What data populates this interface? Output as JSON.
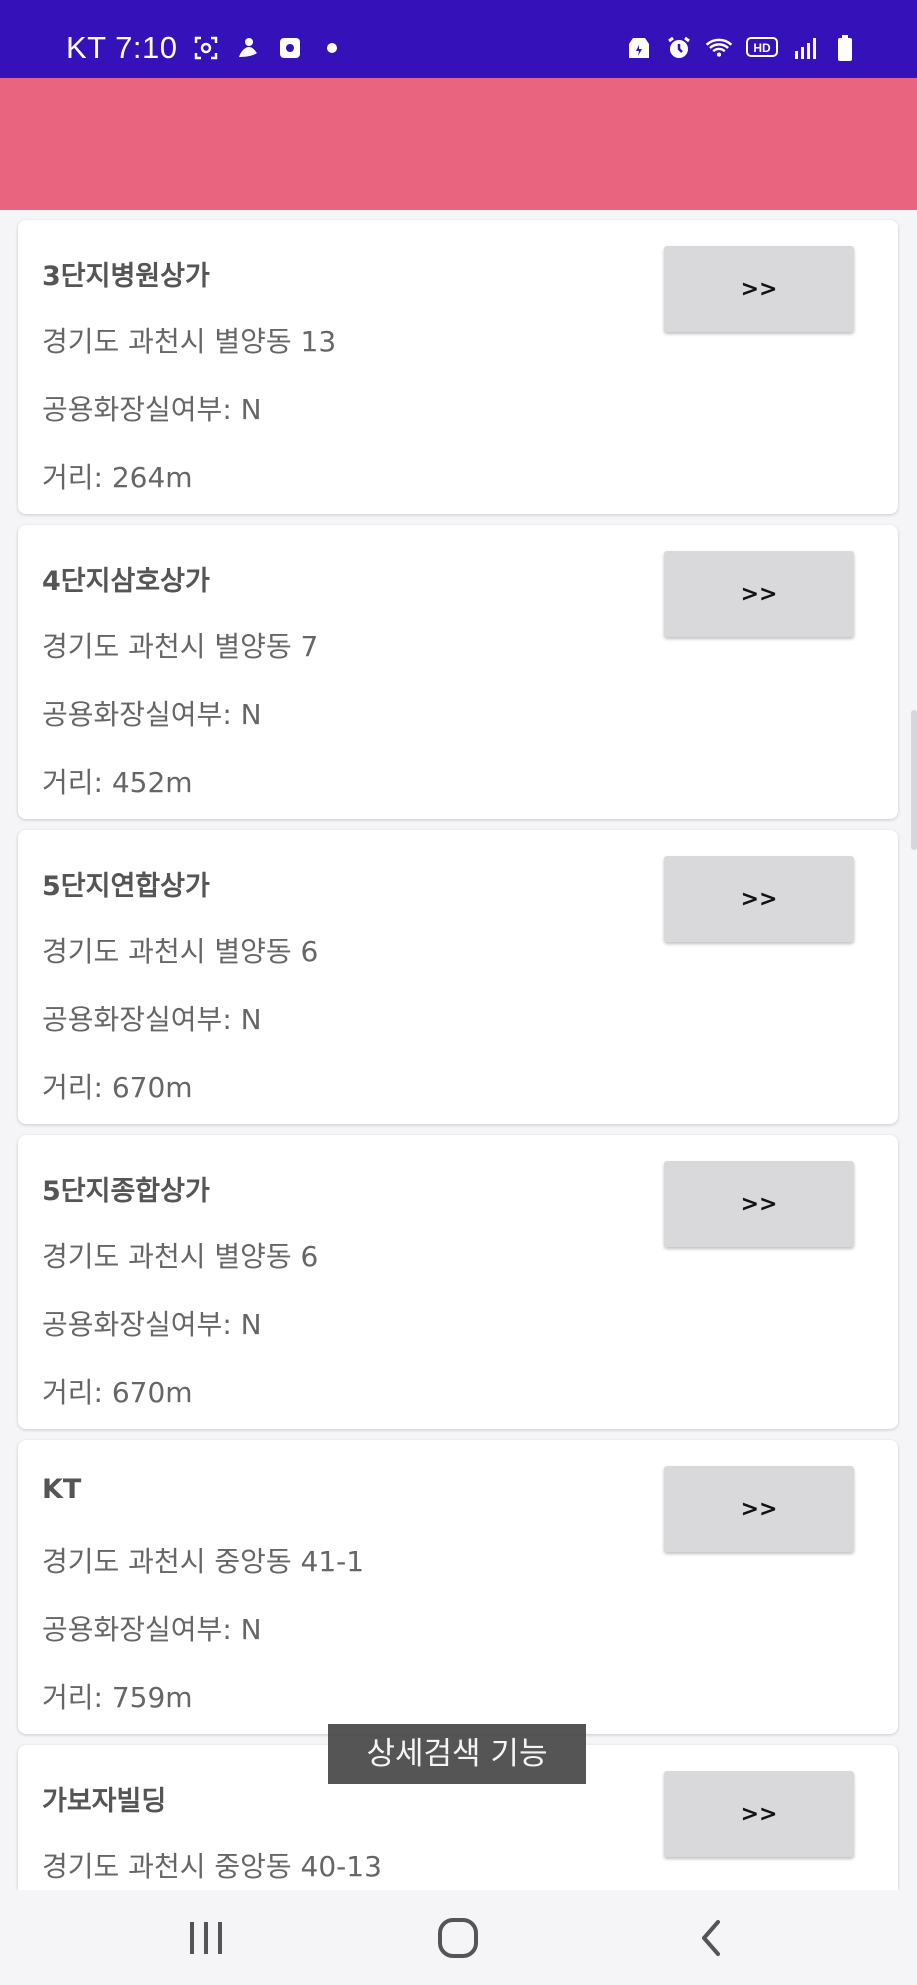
{
  "status_bar": {
    "carrier_time": "KT 7:10",
    "icons_left": [
      "screenshot-icon",
      "app-notification-icon",
      "media-icon",
      "dot-icon"
    ],
    "icons_right": [
      "battery-saver-icon",
      "alarm-icon",
      "wifi-icon",
      "hd-voice-icon",
      "signal-icon",
      "battery-icon"
    ],
    "hd_label": "HD"
  },
  "colors": {
    "status_bar": "#3411b8",
    "app_bar": "#e9647f",
    "card_bg": "#ffffff",
    "button_bg": "#d9d8da"
  },
  "places": [
    {
      "name": "3단지병원상가",
      "address": "경기도 과천시 별양동 13",
      "toilet": "공용화장실여부: N",
      "distance": "거리: 264m",
      "button": ">>"
    },
    {
      "name": "4단지삼호상가",
      "address": "경기도 과천시 별양동 7",
      "toilet": "공용화장실여부: N",
      "distance": "거리: 452m",
      "button": ">>"
    },
    {
      "name": "5단지연합상가",
      "address": "경기도 과천시 별양동 6",
      "toilet": "공용화장실여부: N",
      "distance": "거리: 670m",
      "button": ">>"
    },
    {
      "name": "5단지종합상가",
      "address": "경기도 과천시 별양동 6",
      "toilet": "공용화장실여부: N",
      "distance": "거리: 670m",
      "button": ">>"
    },
    {
      "name": "KT",
      "address": "경기도 과천시 중앙동 41-1",
      "toilet": "공용화장실여부: N",
      "distance": "거리: 759m",
      "button": ">>"
    },
    {
      "name": "가보자빌딩",
      "address": "경기도 과천시 중앙동 40-13",
      "toilet": "",
      "distance": "",
      "button": ">>"
    }
  ],
  "caption": "상세검색 기능",
  "nav": {
    "recent_icon": "recent-apps-icon",
    "home_icon": "home-icon",
    "back_icon": "back-icon"
  }
}
